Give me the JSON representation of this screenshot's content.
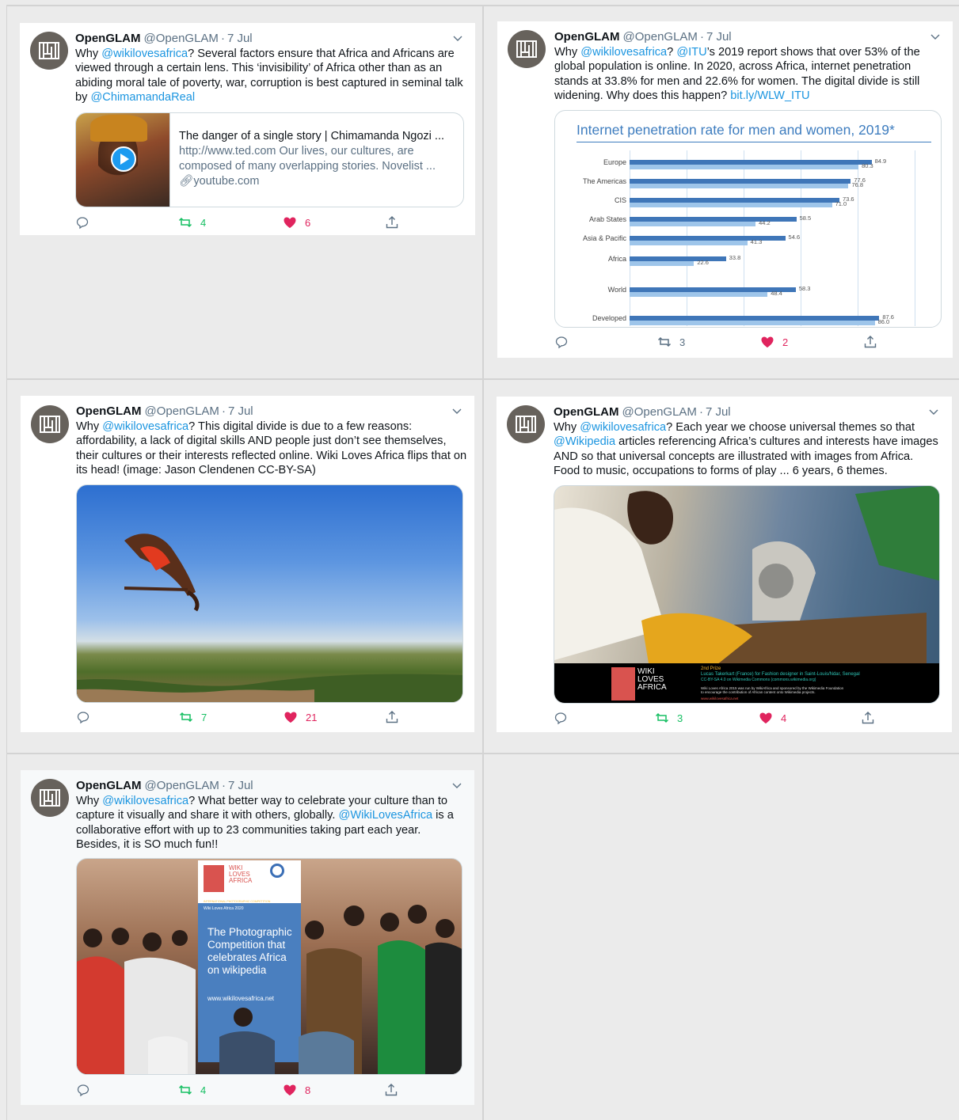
{
  "tweets": [
    {
      "name": "OpenGLAM",
      "handle": "@OpenGLAM",
      "dot": "·",
      "time": "7 Jul",
      "body": [
        {
          "t": "Why "
        },
        {
          "t": "@wikilovesafrica",
          "link": true
        },
        {
          "t": "? Several factors ensure that Africa and Africans are viewed through a certain lens. This ‘invisibility’ of Africa other than as an abiding moral tale of poverty, war, corruption is best captured in seminal talk by "
        },
        {
          "t": "@ChimamandaReal",
          "link": true
        }
      ],
      "card": {
        "title": "The danger of a single story | Chimamanda Ngozi ...",
        "desc": "http://www.ted.com Our lives, our cultures, are composed of many overlapping stories. Novelist ...",
        "host": "youtube.com"
      },
      "retweets": "4",
      "likes": "6"
    },
    {
      "name": "OpenGLAM",
      "handle": "@OpenGLAM",
      "dot": "·",
      "time": "7 Jul",
      "body": [
        {
          "t": "Why "
        },
        {
          "t": "@wikilovesafrica",
          "link": true
        },
        {
          "t": "? "
        },
        {
          "t": "@ITU",
          "link": true
        },
        {
          "t": "’s 2019 report shows that over 53% of the global population is online. In 2020, across Africa, internet penetration stands at 33.8% for men and 22.6% for women. The digital divide is still widening. Why does this happen? "
        },
        {
          "t": "bit.ly/WLW_ITU",
          "link": true
        }
      ],
      "retweets": "3",
      "likes": "2"
    },
    {
      "name": "OpenGLAM",
      "handle": "@OpenGLAM",
      "dot": "·",
      "time": "7 Jul",
      "body": [
        {
          "t": "Why "
        },
        {
          "t": "@wikilovesafrica",
          "link": true
        },
        {
          "t": "? This digital divide is due to a few reasons: affordability, a lack of digital skills AND people just don’t see themselves, their cultures or their interests reflected online. Wiki Loves Africa flips that on its head! (image: Jason Clendenen CC-BY-SA)"
        }
      ],
      "retweets": "7",
      "likes": "21"
    },
    {
      "name": "OpenGLAM",
      "handle": "@OpenGLAM",
      "dot": "·",
      "time": "7 Jul",
      "body": [
        {
          "t": "Why "
        },
        {
          "t": "@wikilovesafrica",
          "link": true
        },
        {
          "t": "? Each year we choose universal themes so that "
        },
        {
          "t": "@Wikipedia",
          "link": true
        },
        {
          "t": " articles referencing Africa’s cultures and interests have images AND so that universal concepts are illustrated with images from Africa. Food to music, occupations to forms of play ... 6 years, 6 themes."
        }
      ],
      "image_overlay": {
        "logo_lines": [
          "WIKI",
          "LOVES",
          "AFRICA"
        ],
        "prize": "2nd Prize",
        "caption": "Lucas Takerkart (France) for Fashion designer in Saint-Louis/Ndar, Senegal",
        "license": "CC-BY-SA 4.0 on Wikimedia Commons (commons.wikimedia.org)",
        "sponsor1": "Wiki Loves Africa 2015 was run by WikiAfrica and sponsored by the Wikimedia Foundation",
        "sponsor2": "to encourage the contribution of African content onto Wikimedia projects.",
        "url": "www.wikilovesafrica.net"
      },
      "retweets": "3",
      "likes": "4"
    },
    {
      "name": "OpenGLAM",
      "handle": "@OpenGLAM",
      "dot": "·",
      "time": "7 Jul",
      "body": [
        {
          "t": "Why "
        },
        {
          "t": "@wikilovesafrica",
          "link": true
        },
        {
          "t": "? What better way to celebrate your culture than to capture it visually and share it with others, globally. "
        },
        {
          "t": "@WikiLovesAfrica",
          "link": true
        },
        {
          "t": " is a collaborative effort with up to 23 communities taking part each year. Besides, it is SO much fun!!"
        }
      ],
      "banner": {
        "logo_lines": [
          "WIKI",
          "LOVES",
          "AFRICA"
        ],
        "sub1": "INTERNATIONAL PHOTOGRAPHIC COMPETITION",
        "sub2": "Wiki Loves Africa 2020",
        "line1": "The Photographic",
        "line2": "Competition that",
        "line3": "celebrates Africa",
        "line4": "on wikipedia",
        "url": "www.wikilovesafrica.net"
      },
      "retweets": "4",
      "likes": "8"
    }
  ],
  "chart_data": {
    "type": "bar",
    "title": "Internet penetration rate for men and women, 2019*",
    "categories": [
      "Europe",
      "The Americas",
      "CIS",
      "Arab States",
      "Asia & Pacific",
      "Africa",
      "World",
      "Developed"
    ],
    "series": [
      {
        "values": [
          84.9,
          77.6,
          73.6,
          58.5,
          54.6,
          33.8,
          58.3,
          87.6
        ]
      },
      {
        "values": [
          80.3,
          76.8,
          71.0,
          44.2,
          41.3,
          22.6,
          48.4,
          86.0
        ]
      }
    ],
    "colors": {
      "men": "#3f76b8",
      "women": "#9ec5ea"
    }
  },
  "colors": {
    "link": "#1b95e0",
    "retweet": "#17bf63",
    "like": "#e0245e",
    "muted": "#5b7083"
  }
}
